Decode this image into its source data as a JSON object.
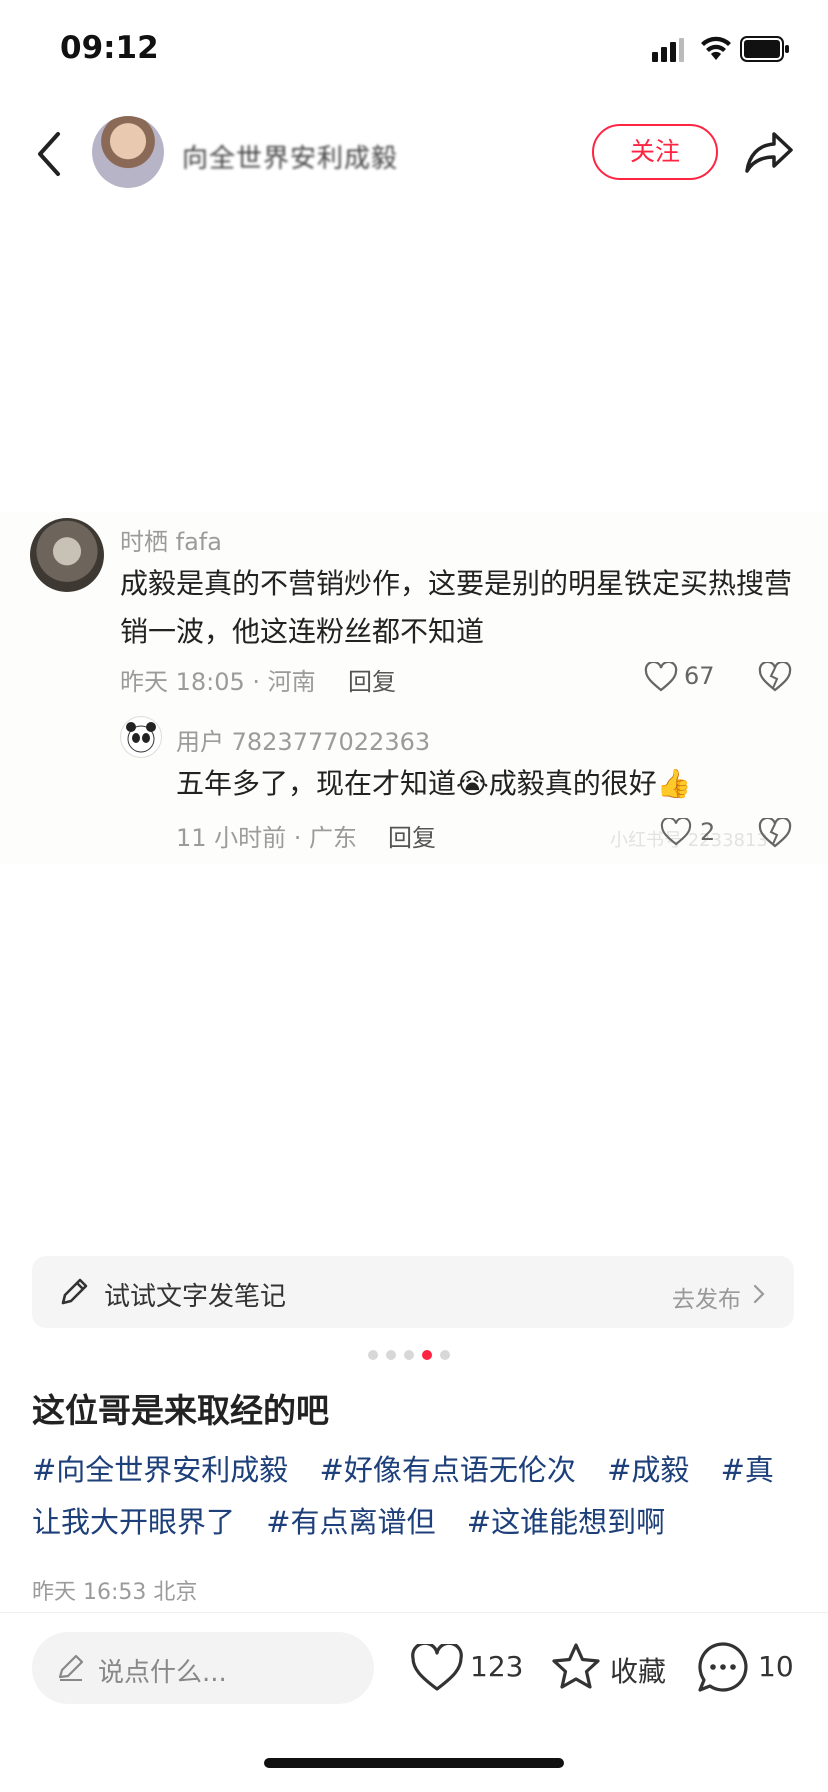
{
  "status_bar": {
    "time": "09:12"
  },
  "header": {
    "author_name": "向全世界安利成毅",
    "follow_label": "关注"
  },
  "screenshot": {
    "comment": {
      "user": "时栖 fafa",
      "text": "成毅是真的不营销炒作，这要是别的明星铁定买热搜营销一波，他这连粉丝都不知道",
      "meta": "昨天 18:05 · 河南",
      "reply_label": "回复",
      "likes": "67"
    },
    "reply": {
      "user": "用户 7823777022363",
      "text": "五年多了，现在才知道😭成毅真的很好👍",
      "meta": "11 小时前 · 广东",
      "reply_label": "回复",
      "likes": "2",
      "watermark": "小红书号 2233813"
    }
  },
  "try_bar": {
    "label": "试试文字发笔记",
    "action": "去发布"
  },
  "post": {
    "title": "这位哥是来取经的吧",
    "tags": [
      "#向全世界安利成毅",
      "#好像有点语无伦次",
      "#成毅",
      "#真让我大开眼界了",
      "#有点离谱但",
      "#这谁能想到啊"
    ],
    "date": "昨天 16:53 北京"
  },
  "carousel": {
    "count": 5,
    "active_index": 3
  },
  "bottom_bar": {
    "input_placeholder": "说点什么...",
    "likes": "123",
    "collect_label": "收藏",
    "comments": "10"
  },
  "colors": {
    "accent": "#ff2442",
    "tag": "#1d3f7a"
  }
}
